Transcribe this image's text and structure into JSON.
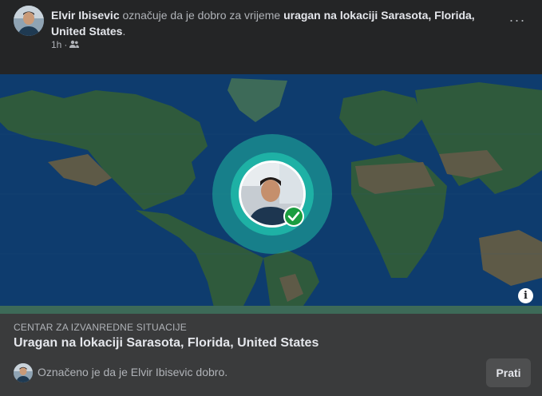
{
  "post": {
    "author_name": "Elvir Ibisevic",
    "action_text": " označuje da je dobro za vrijeme ",
    "event_name": "uragan na lokaciji Sarasota, Florida, United States",
    "trailing": ".",
    "time": "1h",
    "separator": "·",
    "audience_icon": "friends-icon",
    "more_icon": "more-options-icon",
    "more_label": "···"
  },
  "map": {
    "info_icon": "info-icon",
    "info_label": "i",
    "pulse_color": "#1fb6a3",
    "check_color": "#1a9d3f"
  },
  "crisis": {
    "category": "CENTAR ZA IZVANREDNE SITUACIJE",
    "title": "Uragan na lokaciji Sarasota, Florida, United States",
    "status_text": "Označeno je da je Elvir Ibisevic dobro.",
    "follow_label": "Prati"
  },
  "colors": {
    "background": "#242526",
    "footer_background": "#3a3b3c",
    "ocean": "#0e3c6e",
    "land": "#2f5a3c",
    "desert": "#5e5a47"
  }
}
